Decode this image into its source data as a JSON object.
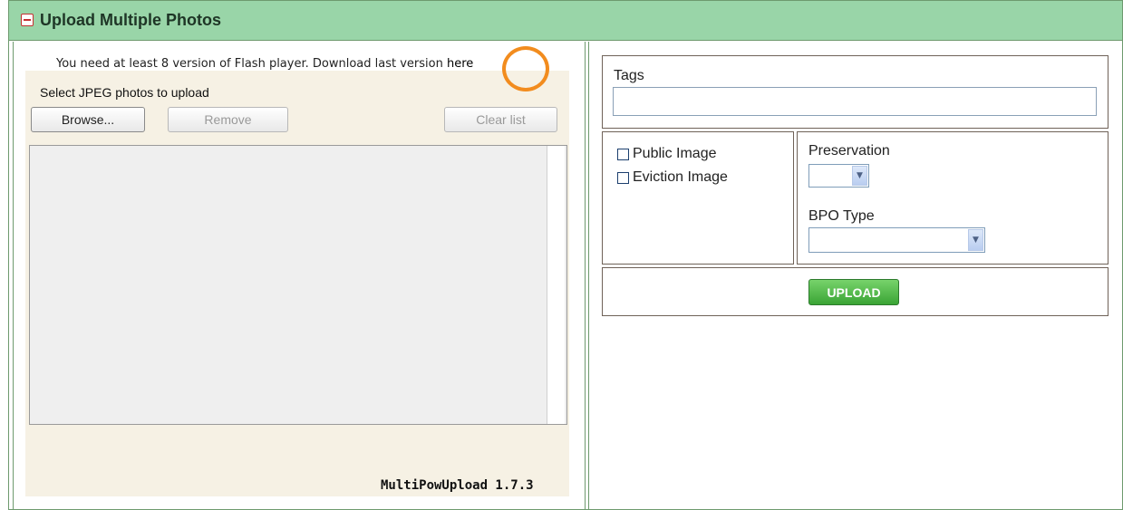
{
  "header": {
    "title": "Upload Multiple Photos",
    "collapse_icon": "minus-square-icon"
  },
  "flash": {
    "message": "You need at least 8 version of Flash player. Download last version ",
    "link_text": "here",
    "select_label": "Select JPEG photos to upload",
    "browse_label": "Browse...",
    "remove_label": "Remove",
    "clear_label": "Clear list",
    "version": "MultiPowUpload 1.7.3"
  },
  "form": {
    "tags_label": "Tags",
    "tags_value": "",
    "public_label": "Public Image",
    "eviction_label": "Eviction Image",
    "preservation_label": "Preservation",
    "preservation_value": "",
    "bpo_label": "BPO Type",
    "bpo_value": "",
    "upload_label": "UPLOAD"
  },
  "colors": {
    "header_bg": "#99d5a8",
    "flash_bg": "#f6f1e4",
    "highlight": "#f28c1e",
    "upload_button": "#3aa435"
  }
}
